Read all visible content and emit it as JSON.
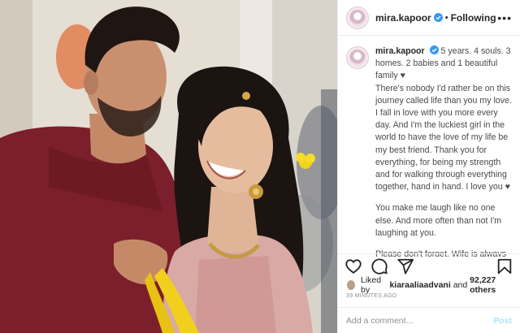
{
  "post": {
    "username": "mira.kapoor",
    "follow_label": "Following",
    "separator": "•",
    "more_label": "•••"
  },
  "caption": {
    "username": "mira.kapoor",
    "line1": "5 years. 4 souls. 3 homes. 2 babies and 1 beautiful family ♥",
    "para1": "There's nobody I'd rather be on this journey called life than you my love. I fall in love with you more every day. And I'm the luckiest girl in the world to have the love of my life be my best friend. Thank you for everything, for being my strength and for walking through everything together, hand in hand. I love you ♥",
    "para2": "You make me laugh like no one else. And more often than not I'm laughing at you.",
    "para3": "Please don't forget. Wife is always right. And the three golden words will"
  },
  "likes": {
    "prefix": "Liked by",
    "user": "kiaraaliaadvani",
    "middle": "and",
    "count": "92,227 others"
  },
  "timestamp": "39 MINUTES AGO",
  "comment": {
    "placeholder": "Add a comment...",
    "post_label": "Post"
  },
  "icons": {
    "like": "heart-icon",
    "comment": "comment-icon",
    "share": "share-icon",
    "save": "bookmark-icon",
    "verified": "verified-badge-icon"
  },
  "colors": {
    "verified_blue": "#3897f0",
    "post_disabled": "#b2dffc",
    "muted": "#8e8e8e"
  }
}
